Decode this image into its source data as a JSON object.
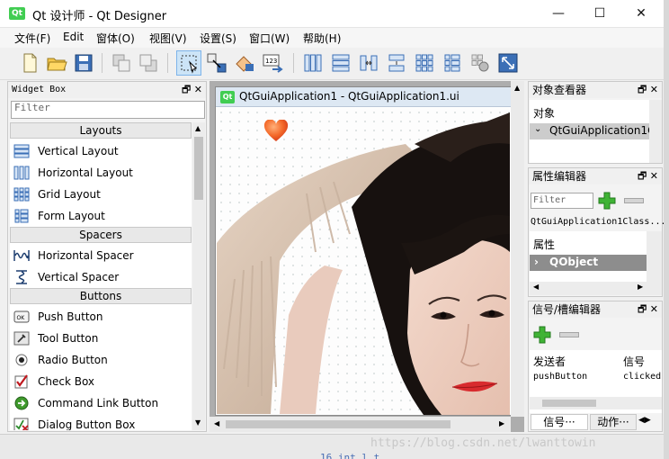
{
  "window": {
    "app_logo": "Qt",
    "title": "Qt 设计师 - Qt Designer",
    "min_glyph": "—",
    "max_glyph": "☐",
    "close_glyph": "✕"
  },
  "menu": [
    "文件(F)",
    "Edit",
    "窗体(O)",
    "视图(V)",
    "设置(S)",
    "窗口(W)",
    "帮助(H)"
  ],
  "toolbar": {
    "icons": [
      "new-file-icon",
      "open-folder-icon",
      "save-icon",
      "send-to-back-icon",
      "bring-to-front-icon",
      "edit-widgets-icon",
      "edit-signals-slots-icon",
      "edit-buddies-icon",
      "edit-tab-order-icon",
      "layout-horizontal-icon",
      "layout-vertical-icon",
      "layout-horizontal-splitter-icon",
      "layout-vertical-splitter-icon",
      "layout-grid-icon",
      "layout-form-icon",
      "break-layout-icon",
      "adjust-size-icon"
    ]
  },
  "widget_box": {
    "title": "Widget Box",
    "dock_buttons": "🗗 ✕",
    "filter_placeholder": "Filter",
    "categories": [
      {
        "label": "Layouts",
        "items": [
          "Vertical Layout",
          "Horizontal Layout",
          "Grid Layout",
          "Form Layout"
        ]
      },
      {
        "label": "Spacers",
        "items": [
          "Horizontal Spacer",
          "Vertical Spacer"
        ]
      },
      {
        "label": "Buttons",
        "items": [
          "Push Button",
          "Tool Button",
          "Radio Button",
          "Check Box",
          "Command Link Button",
          "Dialog Button Box"
        ]
      }
    ]
  },
  "form": {
    "logo": "Qt",
    "title": "QtGuiApplication1 - QtGuiApplication1.ui"
  },
  "object_inspector": {
    "title": "对象查看器",
    "dock_buttons": "🗗 ✕",
    "header": "对象",
    "root": "QtGuiApplication1C"
  },
  "property_editor": {
    "title": "属性编辑器",
    "dock_buttons": "🗗 ✕",
    "filter_placeholder": "Filter",
    "class_label": "QtGuiApplication1Class...",
    "header": "属性",
    "group": "QObject"
  },
  "signal_slot": {
    "title": "信号/槽编辑器",
    "dock_buttons": "🗗 ✕",
    "col_sender": "发送者",
    "col_signal": "信号",
    "row_sender": "pushButton",
    "row_signal": "clicked",
    "tab_signals": "信号···",
    "tab_actions": "动作···"
  },
  "watermark": "https://blog.csdn.net/lwanttowin",
  "behind_code": "16  int  l  t"
}
